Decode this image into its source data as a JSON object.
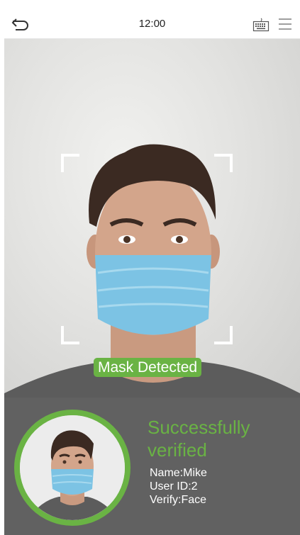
{
  "status_bar": {
    "time": "12:00"
  },
  "icons": {
    "back": "back-arrow-icon",
    "keyboard": "keyboard-icon",
    "menu": "menu-icon"
  },
  "camera": {
    "detection_label": "Mask Detected"
  },
  "result": {
    "title": "Successfully verified",
    "name": "Name:Mike",
    "user_id": "User ID:2",
    "verify": "Verify:Face"
  },
  "colors": {
    "accent_green": "#6ab344",
    "panel": "#505050",
    "frame_corners": "#ffffff"
  }
}
